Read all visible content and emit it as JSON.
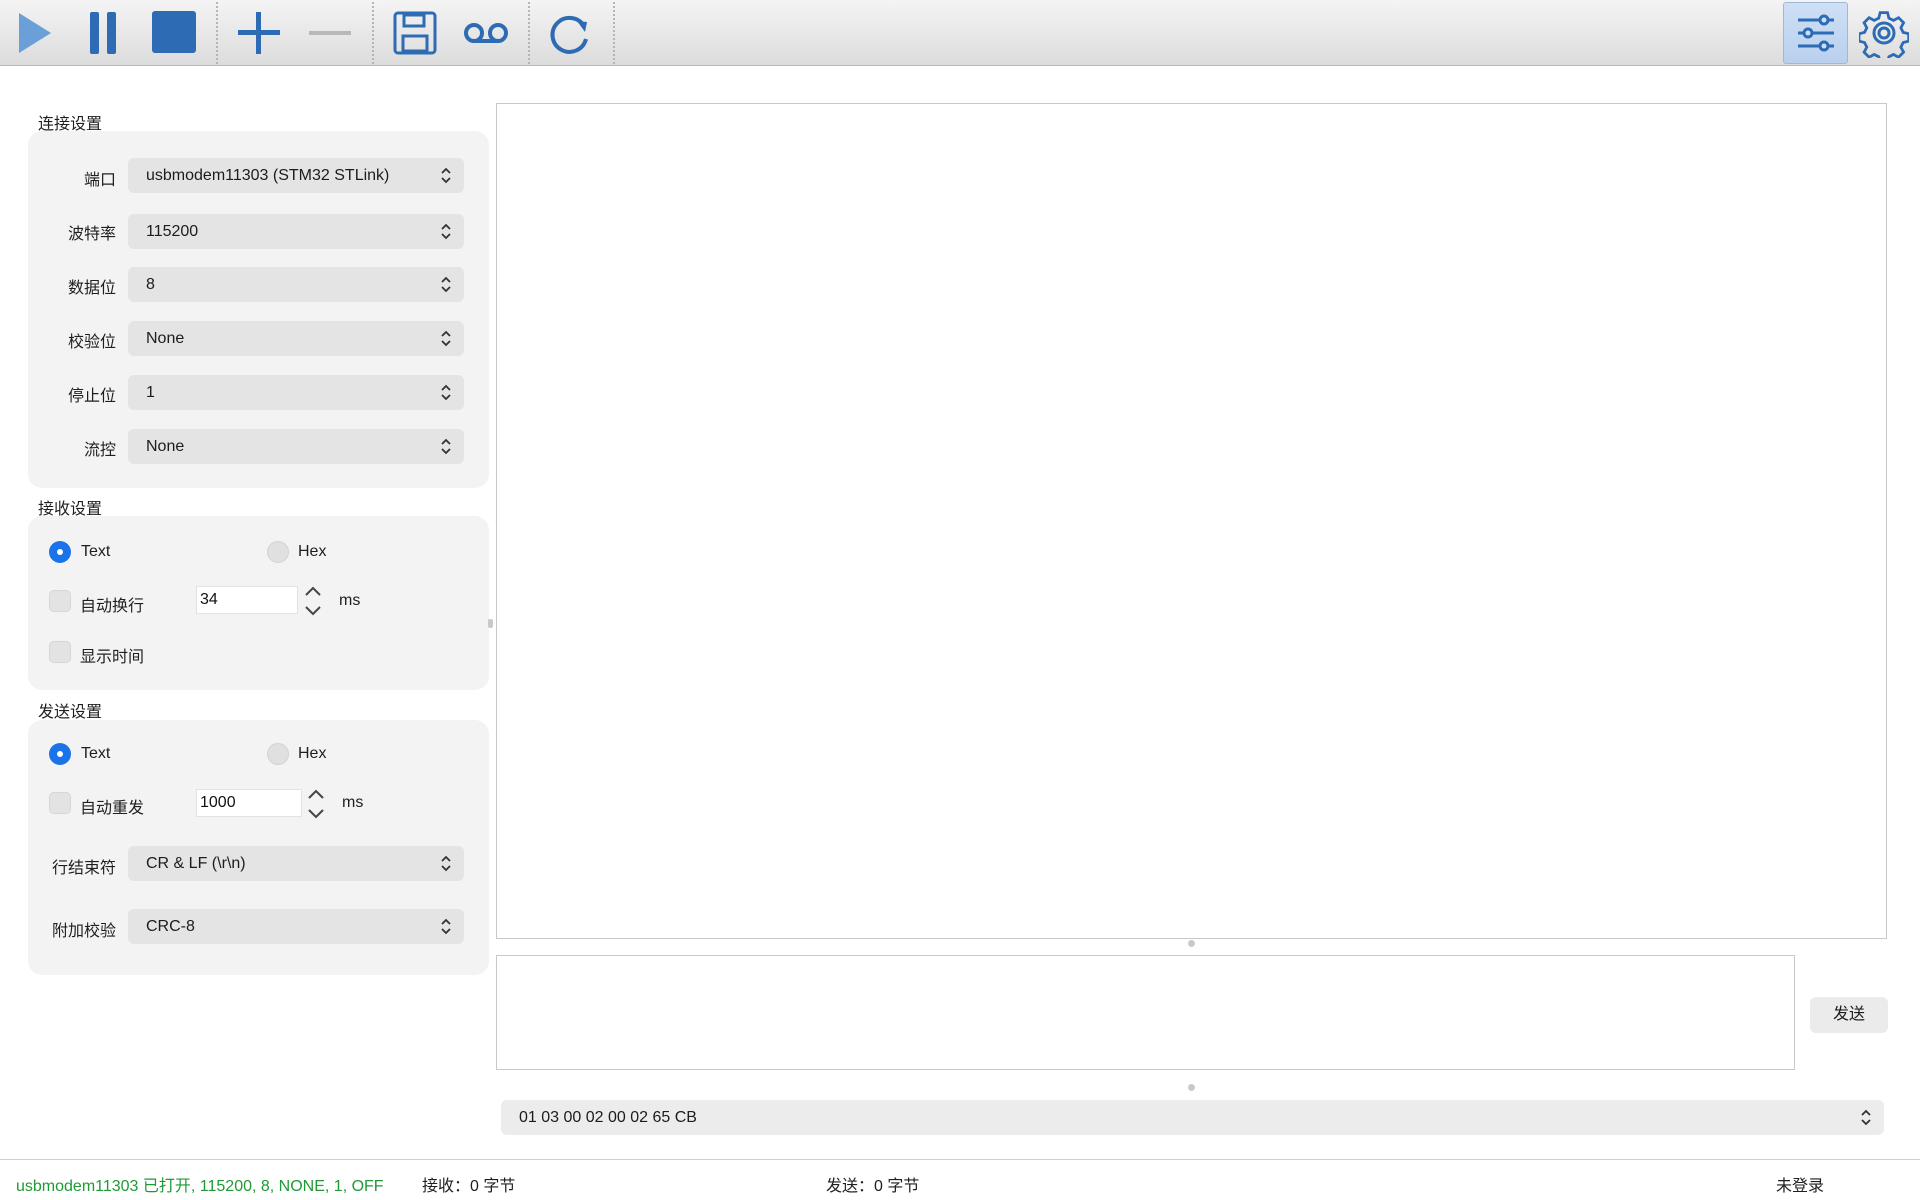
{
  "toolbar": {
    "buttons": [
      "play-icon",
      "pause-icon",
      "stop-icon",
      "plus-icon",
      "minus-icon",
      "save-icon",
      "voicemail-icon",
      "refresh-icon",
      "sliders-icon",
      "gear-icon"
    ],
    "accent": "#2d6bb4",
    "play_color": "#6a9fd8",
    "disabled_color": "#b8b8b8"
  },
  "connection": {
    "title": "连接设置",
    "port_label": "端口",
    "port_value": "usbmodem11303 (STM32 STLink)",
    "baud_label": "波特率",
    "baud_value": "115200",
    "databits_label": "数据位",
    "databits_value": "8",
    "parity_label": "校验位",
    "parity_value": "None",
    "stopbits_label": "停止位",
    "stopbits_value": "1",
    "flow_label": "流控",
    "flow_value": "None"
  },
  "receive": {
    "title": "接收设置",
    "text_label": "Text",
    "hex_label": "Hex",
    "mode_selected": "Text",
    "autowrap_label": "自动换行",
    "autowrap_checked": false,
    "autowrap_value": "34",
    "autowrap_unit": "ms",
    "showtime_label": "显示时间",
    "showtime_checked": false
  },
  "send": {
    "title": "发送设置",
    "text_label": "Text",
    "hex_label": "Hex",
    "mode_selected": "Text",
    "autoresend_label": "自动重发",
    "autoresend_checked": false,
    "autoresend_value": "1000",
    "autoresend_unit": "ms",
    "eol_label": "行结束符",
    "eol_value": "CR & LF (\\r\\n)",
    "checksum_label": "附加校验",
    "checksum_value": "CRC-8",
    "send_button": "发送",
    "history_value": "01 03 00 02 00 02 65 CB"
  },
  "status": {
    "connection": "usbmodem11303 已打开, 115200, 8, NONE, 1, OFF",
    "received": "接收：0 字节",
    "sent": "发送：0 字节",
    "login": "未登录",
    "connection_color": "#1f9a35"
  }
}
